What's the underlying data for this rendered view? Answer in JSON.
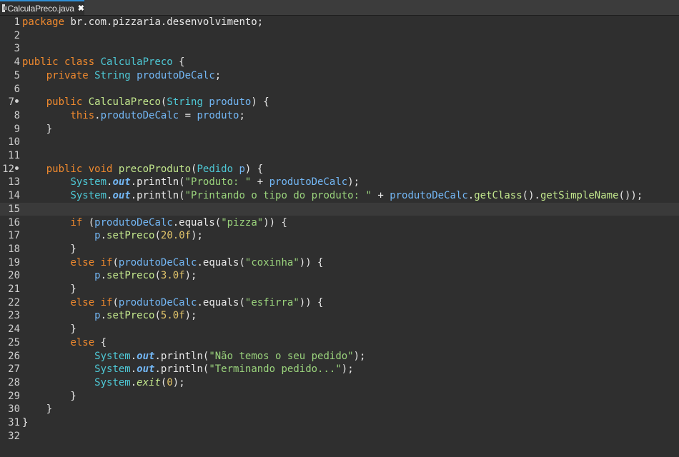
{
  "tab": {
    "title": "CalculaPreco.java",
    "close_label": "✖"
  },
  "lines": [
    {
      "n": "1",
      "tokens": [
        [
          "kw",
          "package"
        ],
        [
          "pl",
          " br.com.pizzaria.desenvolvimento;"
        ]
      ]
    },
    {
      "n": "2",
      "tokens": []
    },
    {
      "n": "3",
      "tokens": []
    },
    {
      "n": "4",
      "tokens": [
        [
          "kw",
          "public class "
        ],
        [
          "ty",
          "CalculaPreco"
        ],
        [
          "pl",
          " {"
        ]
      ]
    },
    {
      "n": "5",
      "tokens": [
        [
          "pl",
          "    "
        ],
        [
          "kw",
          "private "
        ],
        [
          "ty",
          "String "
        ],
        [
          "fd",
          "produtoDeCalc"
        ],
        [
          "pl",
          ";"
        ]
      ]
    },
    {
      "n": "6",
      "tokens": []
    },
    {
      "n": "7",
      "bp": true,
      "tokens": [
        [
          "pl",
          "    "
        ],
        [
          "kw",
          "public "
        ],
        [
          "mt",
          "CalculaPreco"
        ],
        [
          "pl",
          "("
        ],
        [
          "ty",
          "String "
        ],
        [
          "vr",
          "produto"
        ],
        [
          "pl",
          ") {"
        ]
      ]
    },
    {
      "n": "8",
      "tokens": [
        [
          "pl",
          "        "
        ],
        [
          "kw",
          "this"
        ],
        [
          "pl",
          "."
        ],
        [
          "fd",
          "produtoDeCalc"
        ],
        [
          "pl",
          " = "
        ],
        [
          "vr",
          "produto"
        ],
        [
          "pl",
          ";"
        ]
      ]
    },
    {
      "n": "9",
      "tokens": [
        [
          "pl",
          "    }"
        ]
      ]
    },
    {
      "n": "10",
      "tokens": []
    },
    {
      "n": "11",
      "tokens": []
    },
    {
      "n": "12",
      "bp": true,
      "tokens": [
        [
          "pl",
          "    "
        ],
        [
          "kw",
          "public void "
        ],
        [
          "mt",
          "precoProduto"
        ],
        [
          "pl",
          "("
        ],
        [
          "ty",
          "Pedido "
        ],
        [
          "vr",
          "p"
        ],
        [
          "pl",
          ") {"
        ]
      ]
    },
    {
      "n": "13",
      "tokens": [
        [
          "pl",
          "        "
        ],
        [
          "ty",
          "System"
        ],
        [
          "pl",
          "."
        ],
        [
          "fi",
          "out"
        ],
        [
          "pl",
          ".println("
        ],
        [
          "st",
          "\"Produto: \""
        ],
        [
          "pl",
          " + "
        ],
        [
          "fd",
          "produtoDeCalc"
        ],
        [
          "pl",
          ");"
        ]
      ]
    },
    {
      "n": "14",
      "tokens": [
        [
          "pl",
          "        "
        ],
        [
          "ty",
          "System"
        ],
        [
          "pl",
          "."
        ],
        [
          "fi",
          "out"
        ],
        [
          "pl",
          ".println("
        ],
        [
          "st",
          "\"Printando o tipo do produto: \""
        ],
        [
          "pl",
          " + "
        ],
        [
          "fd",
          "produtoDeCalc"
        ],
        [
          "pl",
          "."
        ],
        [
          "mt",
          "getClass"
        ],
        [
          "pl",
          "()."
        ],
        [
          "mt",
          "getSimpleName"
        ],
        [
          "pl",
          "());"
        ]
      ]
    },
    {
      "n": "15",
      "current": true,
      "tokens": []
    },
    {
      "n": "16",
      "tokens": [
        [
          "pl",
          "        "
        ],
        [
          "kw",
          "if "
        ],
        [
          "pl",
          "("
        ],
        [
          "fd",
          "produtoDeCalc"
        ],
        [
          "pl",
          ".equals("
        ],
        [
          "st",
          "\"pizza\""
        ],
        [
          "pl",
          ")) {"
        ]
      ]
    },
    {
      "n": "17",
      "tokens": [
        [
          "pl",
          "            "
        ],
        [
          "vr",
          "p"
        ],
        [
          "pl",
          "."
        ],
        [
          "mt",
          "setPreco"
        ],
        [
          "pl",
          "("
        ],
        [
          "nu",
          "20.0f"
        ],
        [
          "pl",
          ");"
        ]
      ]
    },
    {
      "n": "18",
      "tokens": [
        [
          "pl",
          "        }"
        ]
      ]
    },
    {
      "n": "19",
      "tokens": [
        [
          "pl",
          "        "
        ],
        [
          "kw",
          "else if"
        ],
        [
          "pl",
          "("
        ],
        [
          "fd",
          "produtoDeCalc"
        ],
        [
          "pl",
          ".equals("
        ],
        [
          "st",
          "\"coxinha\""
        ],
        [
          "pl",
          ")) {"
        ]
      ]
    },
    {
      "n": "20",
      "tokens": [
        [
          "pl",
          "            "
        ],
        [
          "vr",
          "p"
        ],
        [
          "pl",
          "."
        ],
        [
          "mt",
          "setPreco"
        ],
        [
          "pl",
          "("
        ],
        [
          "nu",
          "3.0f"
        ],
        [
          "pl",
          ");"
        ]
      ]
    },
    {
      "n": "21",
      "tokens": [
        [
          "pl",
          "        }"
        ]
      ]
    },
    {
      "n": "22",
      "tokens": [
        [
          "pl",
          "        "
        ],
        [
          "kw",
          "else if"
        ],
        [
          "pl",
          "("
        ],
        [
          "fd",
          "produtoDeCalc"
        ],
        [
          "pl",
          ".equals("
        ],
        [
          "st",
          "\"esfirra\""
        ],
        [
          "pl",
          ")) {"
        ]
      ]
    },
    {
      "n": "23",
      "tokens": [
        [
          "pl",
          "            "
        ],
        [
          "vr",
          "p"
        ],
        [
          "pl",
          "."
        ],
        [
          "mt",
          "setPreco"
        ],
        [
          "pl",
          "("
        ],
        [
          "nu",
          "5.0f"
        ],
        [
          "pl",
          ");"
        ]
      ]
    },
    {
      "n": "24",
      "tokens": [
        [
          "pl",
          "        }"
        ]
      ]
    },
    {
      "n": "25",
      "tokens": [
        [
          "pl",
          "        "
        ],
        [
          "kw",
          "else "
        ],
        [
          "pl",
          "{"
        ]
      ]
    },
    {
      "n": "26",
      "tokens": [
        [
          "pl",
          "            "
        ],
        [
          "ty",
          "System"
        ],
        [
          "pl",
          "."
        ],
        [
          "fi",
          "out"
        ],
        [
          "pl",
          ".println("
        ],
        [
          "st",
          "\"Não temos o seu pedido\""
        ],
        [
          "pl",
          ");"
        ]
      ]
    },
    {
      "n": "27",
      "tokens": [
        [
          "pl",
          "            "
        ],
        [
          "ty",
          "System"
        ],
        [
          "pl",
          "."
        ],
        [
          "fi",
          "out"
        ],
        [
          "pl",
          ".println("
        ],
        [
          "st",
          "\"Terminando pedido...\""
        ],
        [
          "pl",
          ");"
        ]
      ]
    },
    {
      "n": "28",
      "tokens": [
        [
          "pl",
          "            "
        ],
        [
          "ty",
          "System"
        ],
        [
          "pl",
          "."
        ],
        [
          "it",
          "exit"
        ],
        [
          "pl",
          "("
        ],
        [
          "nu",
          "0"
        ],
        [
          "pl",
          ");"
        ]
      ]
    },
    {
      "n": "29",
      "tokens": [
        [
          "pl",
          "        }"
        ]
      ]
    },
    {
      "n": "30",
      "tokens": [
        [
          "pl",
          "    }"
        ]
      ]
    },
    {
      "n": "31",
      "tokens": [
        [
          "pl",
          "}"
        ]
      ]
    },
    {
      "n": "32",
      "tokens": []
    }
  ],
  "colors": {
    "background": "#2f2f2f",
    "keyword": "#f18a2e",
    "type": "#4ec9d6",
    "field": "#73b7f5",
    "string": "#9ad37c",
    "number": "#e0c36a",
    "method": "#c3e88d",
    "tab_accent": "#2f8fd5"
  },
  "icons": {
    "tab_file": "java-file-icon",
    "breakpoint": "breakpoint-dot-icon"
  }
}
